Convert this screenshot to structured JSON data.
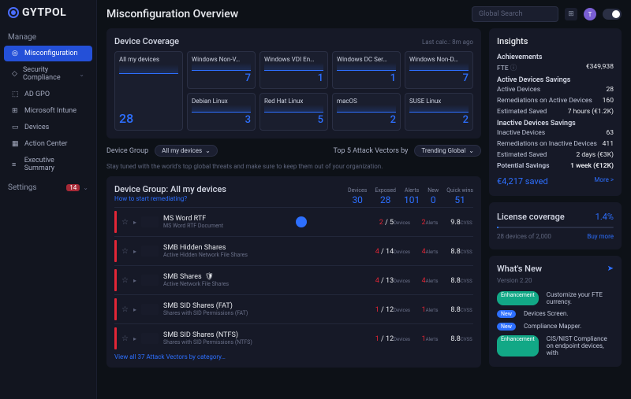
{
  "brand": "GYTPOL",
  "page_title": "Misconfiguration Overview",
  "global_search_placeholder": "Global Search",
  "avatar_letter": "T",
  "sidebar": {
    "manage_label": "Manage",
    "settings_label": "Settings",
    "settings_badge": "14",
    "items": [
      {
        "label": "Misconfiguration"
      },
      {
        "label": "Security Compliance"
      },
      {
        "label": "AD GPO"
      },
      {
        "label": "Microsoft Intune"
      },
      {
        "label": "Devices"
      },
      {
        "label": "Action Center"
      },
      {
        "label": "Executive Summary"
      }
    ]
  },
  "device_coverage": {
    "title": "Device Coverage",
    "last_calc": "Last calc.: 8m ago",
    "cards": [
      {
        "name": "All my devices",
        "value": "28"
      },
      {
        "name": "Windows Non-V…",
        "value": "7"
      },
      {
        "name": "Windows VDI En…",
        "value": "1"
      },
      {
        "name": "Windows DC Ser…",
        "value": "1"
      },
      {
        "name": "Windows Non-D…",
        "value": "7"
      },
      {
        "name": "Debian Linux",
        "value": "3"
      },
      {
        "name": "Red Hat Linux",
        "value": "5"
      },
      {
        "name": "macOS",
        "value": "2"
      },
      {
        "name": "SUSE Linux",
        "value": "2"
      }
    ]
  },
  "filters": {
    "device_group_label": "Device Group",
    "device_group_value": "All my devices",
    "top5_label": "Top 5 Attack Vectors by",
    "top5_value": "Trending Global",
    "tip": "Stay tuned with the world's top global threats and make sure to keep them out of your organization."
  },
  "vectors_panel": {
    "title": "Device Group: All my devices",
    "how_link": "How to start remediating?",
    "stats": [
      {
        "label": "Devices",
        "value": "30"
      },
      {
        "label": "Exposed",
        "value": "28"
      },
      {
        "label": "Alerts",
        "value": "101"
      },
      {
        "label": "New",
        "value": "0"
      },
      {
        "label": "Quick wins",
        "value": "51"
      }
    ],
    "rows": [
      {
        "name": "MS Word RTF",
        "sub": "MS Word RTF Document",
        "compass": true,
        "devices_e": "2",
        "devices_t": "5",
        "alerts": "2",
        "cvss": "9.8"
      },
      {
        "name": "SMB Hidden Shares",
        "sub": "Active Hidden Network File Shares",
        "devices_e": "4",
        "devices_t": "14",
        "alerts": "4",
        "cvss": "8.8"
      },
      {
        "name": "SMB Shares",
        "sub": "Active Network File Shares",
        "shield": true,
        "devices_e": "4",
        "devices_t": "13",
        "alerts": "4",
        "cvss": "8.8"
      },
      {
        "name": "SMB SID Shares (FAT)",
        "sub": "Shares with SID Permissions (FAT)",
        "devices_e": "1",
        "devices_t": "12",
        "alerts": "1",
        "cvss": "8.8"
      },
      {
        "name": "SMB SID Shares (NTFS)",
        "sub": "Shares with SID Permissions (NTFS)",
        "devices_e": "1",
        "devices_t": "12",
        "alerts": "1",
        "cvss": "8.8"
      }
    ],
    "view_all": "View all 37 Attack Vectors by category…",
    "vm_labels": {
      "devices": "Devices",
      "alerts": "Alerts",
      "cvss": "CVSS"
    }
  },
  "insights": {
    "title": "Insights",
    "ach_title": "Achievements",
    "fte_label": "FTE",
    "fte_info": "ⓘ",
    "fte_value": "€349,938",
    "active_title": "Active Devices Savings",
    "active_rows": [
      {
        "k": "Active Devices",
        "v": "28"
      },
      {
        "k": "Remediations on Active Devices",
        "v": "160"
      },
      {
        "k": "Estimated Saved",
        "v": "7 hours (€1.2K)"
      }
    ],
    "inactive_title": "Inactive Devices Savings",
    "inactive_rows": [
      {
        "k": "Inactive Devices",
        "v": "63"
      },
      {
        "k": "Remediations on Inactive Devices",
        "v": "411"
      },
      {
        "k": "Estimated Saved",
        "v": "2 days (€3K)"
      }
    ],
    "potential_k": "Potential Savings",
    "potential_v": "1 week (€12K)",
    "saved_line": "€4,217 saved",
    "more": "More >"
  },
  "license": {
    "title": "License coverage",
    "pct": "1.4%",
    "text": "28 devices of 2,000",
    "buy": "Buy more"
  },
  "whatsnew": {
    "title": "What's New",
    "version": "Version 2.20",
    "items": [
      {
        "tag": "Enhancement",
        "tag_cls": "tag-teal",
        "text": "Customize your FTE currency."
      },
      {
        "tag": "New",
        "tag_cls": "tag-blue",
        "text": "Devices Screen."
      },
      {
        "tag": "New",
        "tag_cls": "tag-blue",
        "text": "Compliance Mapper."
      },
      {
        "tag": "Enhancement",
        "tag_cls": "tag-teal",
        "text": "CIS/NIST Compliance on endpoint devices, with"
      }
    ]
  }
}
